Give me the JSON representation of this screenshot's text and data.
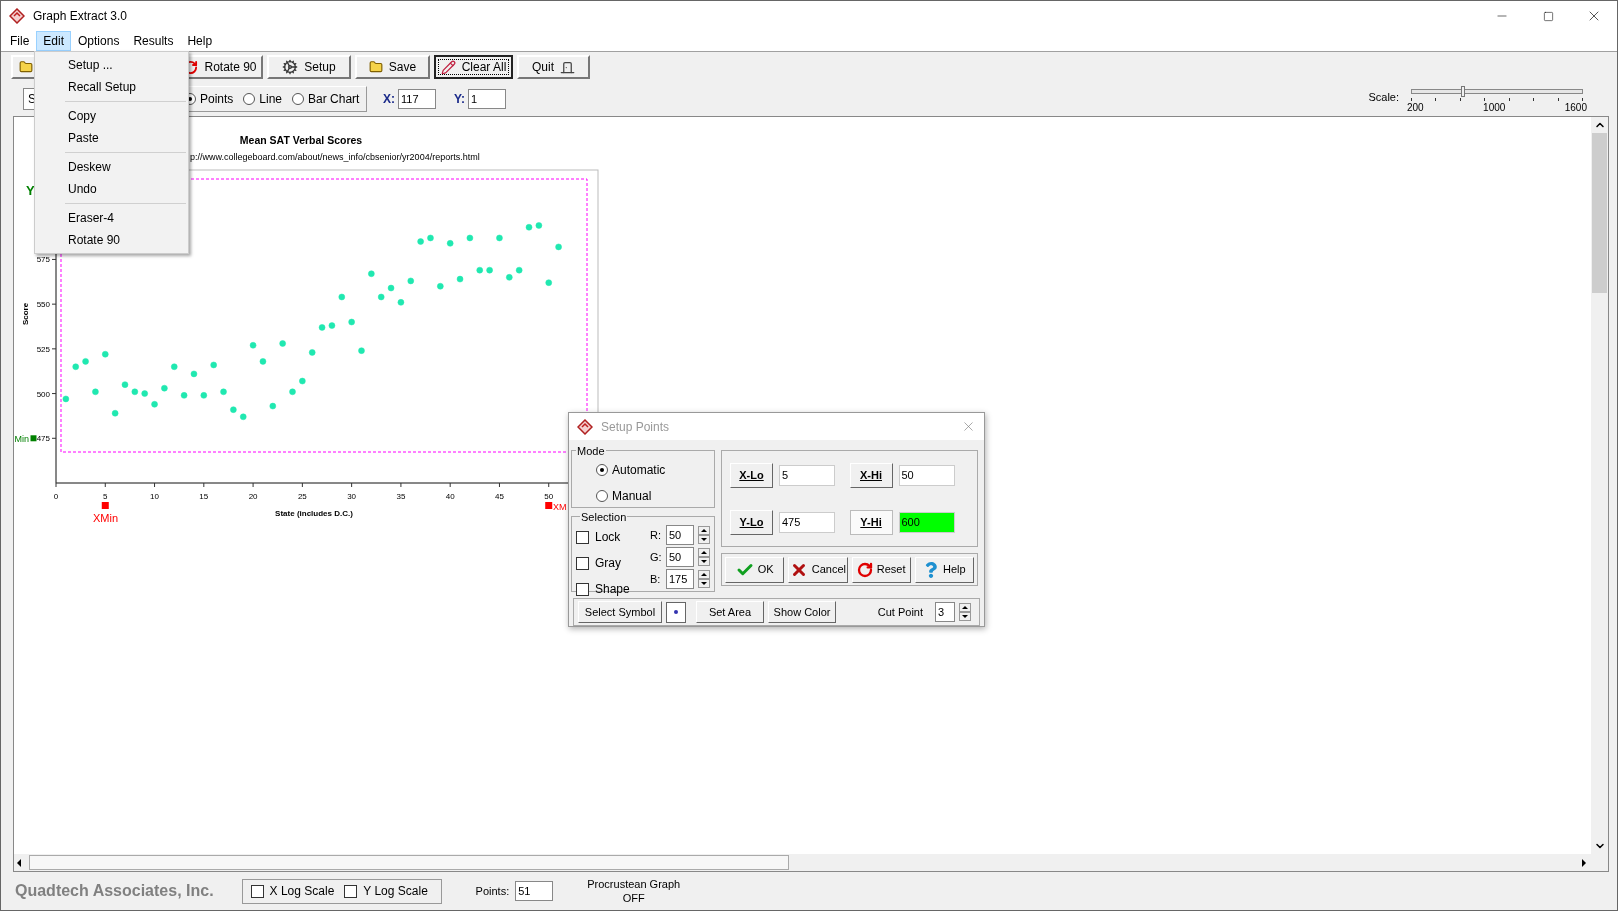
{
  "window": {
    "title": "Graph Extract 3.0"
  },
  "menu_bar": [
    {
      "label": "File",
      "selected": false
    },
    {
      "label": "Edit",
      "selected": true
    },
    {
      "label": "Options",
      "selected": false
    },
    {
      "label": "Results",
      "selected": false
    },
    {
      "label": "Help",
      "selected": false
    }
  ],
  "open_menu": {
    "groups": [
      {
        "items": [
          "Setup ...",
          "Recall Setup"
        ]
      },
      {
        "items": [
          "Copy",
          "Paste"
        ]
      },
      {
        "items": [
          "Deskew",
          "Undo"
        ]
      },
      {
        "items": [
          "Eraser-4",
          "Rotate 90"
        ]
      }
    ]
  },
  "toolbar": [
    {
      "kind": "open",
      "selected": false
    },
    {
      "kind": "rotate",
      "label": "Rotate 90",
      "selected": false
    },
    {
      "kind": "setup",
      "label": "Setup",
      "selected": false
    },
    {
      "kind": "save",
      "label": "Save",
      "selected": false
    },
    {
      "kind": "clear",
      "label": "Clear All",
      "selected": true
    },
    {
      "kind": "quit",
      "label": "Quit",
      "selected": false
    }
  ],
  "source_field": {
    "value": "S"
  },
  "plot_type": [
    {
      "label": "Points",
      "selected": true
    },
    {
      "label": "Line",
      "selected": false
    },
    {
      "label": "Bar Chart",
      "selected": false
    }
  ],
  "coordinates": [
    {
      "label": "X:",
      "value": "117"
    },
    {
      "label": "Y:",
      "value": "1"
    }
  ],
  "scale": {
    "label": "Scale:",
    "level": 0.3,
    "tick_labels": [
      "200",
      "1000",
      "1600"
    ]
  },
  "graph": {
    "subtitle": "p://www.collegeboard.com/about/news_info/cbsenior/yr2004/reports.html",
    "markers": [
      {
        "kind": "y_max",
        "label": "Y",
        "color": "#008000"
      },
      {
        "kind": "y_min",
        "label": "Min",
        "color": "#008000"
      },
      {
        "kind": "x_min",
        "label": "XMin",
        "color": "#ff0000"
      },
      {
        "kind": "x_max",
        "label": "XM",
        "color": "#ff0000"
      }
    ],
    "chart_data": {
      "type": "scatter",
      "title": "Mean SAT Verbal Scores",
      "xlabel": "State (includes D.C.)",
      "ylabel": "Score",
      "x": [
        1,
        2,
        3,
        4,
        5,
        6,
        7,
        8,
        9,
        10,
        11,
        12,
        13,
        14,
        15,
        16,
        17,
        18,
        19,
        20,
        21,
        22,
        23,
        24,
        25,
        26,
        27,
        28,
        29,
        30,
        31,
        32,
        33,
        34,
        35,
        36,
        37,
        38,
        39,
        40,
        41,
        42,
        43,
        44,
        45,
        46,
        47,
        48,
        49,
        50,
        51
      ],
      "series": [
        {
          "color": "#20e8b0",
          "values": [
            497,
            515,
            518,
            501,
            522,
            489,
            505,
            501,
            500,
            494,
            503,
            515,
            499,
            511,
            499,
            516,
            501,
            491,
            487,
            527,
            518,
            493,
            528,
            501,
            507,
            523,
            537,
            538,
            554,
            540,
            524,
            567,
            554,
            559,
            551,
            563,
            585,
            587,
            560,
            584,
            564,
            587,
            569,
            569,
            587,
            565,
            569,
            593,
            594,
            562,
            582
          ]
        }
      ],
      "xlim": [
        0,
        55
      ],
      "ylim": [
        450,
        625
      ],
      "xticks": [
        0,
        5,
        10,
        15,
        20,
        25,
        30,
        35,
        40,
        45,
        50
      ],
      "yticks": [
        475,
        500,
        525,
        550,
        575
      ]
    }
  },
  "setup_dialog": {
    "title": "Setup Points",
    "mode": {
      "label": "Mode",
      "options": [
        {
          "label": "Automatic",
          "selected": true
        },
        {
          "label": "Manual",
          "selected": false
        }
      ]
    },
    "selection": {
      "label": "Selection",
      "checks": [
        {
          "label": "Lock",
          "checked": false
        },
        {
          "label": "Gray",
          "checked": false
        },
        {
          "label": "Shape",
          "checked": false
        }
      ],
      "colors": [
        {
          "label": "R:",
          "value": "50"
        },
        {
          "label": "G:",
          "value": "50"
        },
        {
          "label": "B:",
          "value": "175"
        }
      ]
    },
    "limits": [
      {
        "label": "X-Lo",
        "value": "5",
        "selected": false
      },
      {
        "label": "X-Hi",
        "value": "50",
        "selected": false
      },
      {
        "label": "Y-Lo",
        "value": "475",
        "selected": false
      },
      {
        "label": "Y-Hi",
        "value": "600",
        "selected": true
      }
    ],
    "actions": [
      {
        "kind": "ok",
        "label": "OK"
      },
      {
        "kind": "cancel",
        "label": "Cancel"
      },
      {
        "kind": "reset",
        "label": "Reset"
      },
      {
        "kind": "help",
        "label": "Help"
      }
    ],
    "symbol_buttons": [
      "Select Symbol",
      "Set Area",
      "Show Color"
    ],
    "cut_point": {
      "label": "Cut Point",
      "value": "3"
    }
  },
  "status_bar": {
    "company": "Quadtech Associates, Inc.",
    "log_scales": [
      {
        "label": "X Log Scale",
        "checked": false
      },
      {
        "label": "Y Log Scale",
        "checked": false
      }
    ],
    "points_label": "Points:",
    "points_value": "51",
    "procrustean": {
      "label": "Procrustean Graph",
      "state": "OFF"
    }
  }
}
